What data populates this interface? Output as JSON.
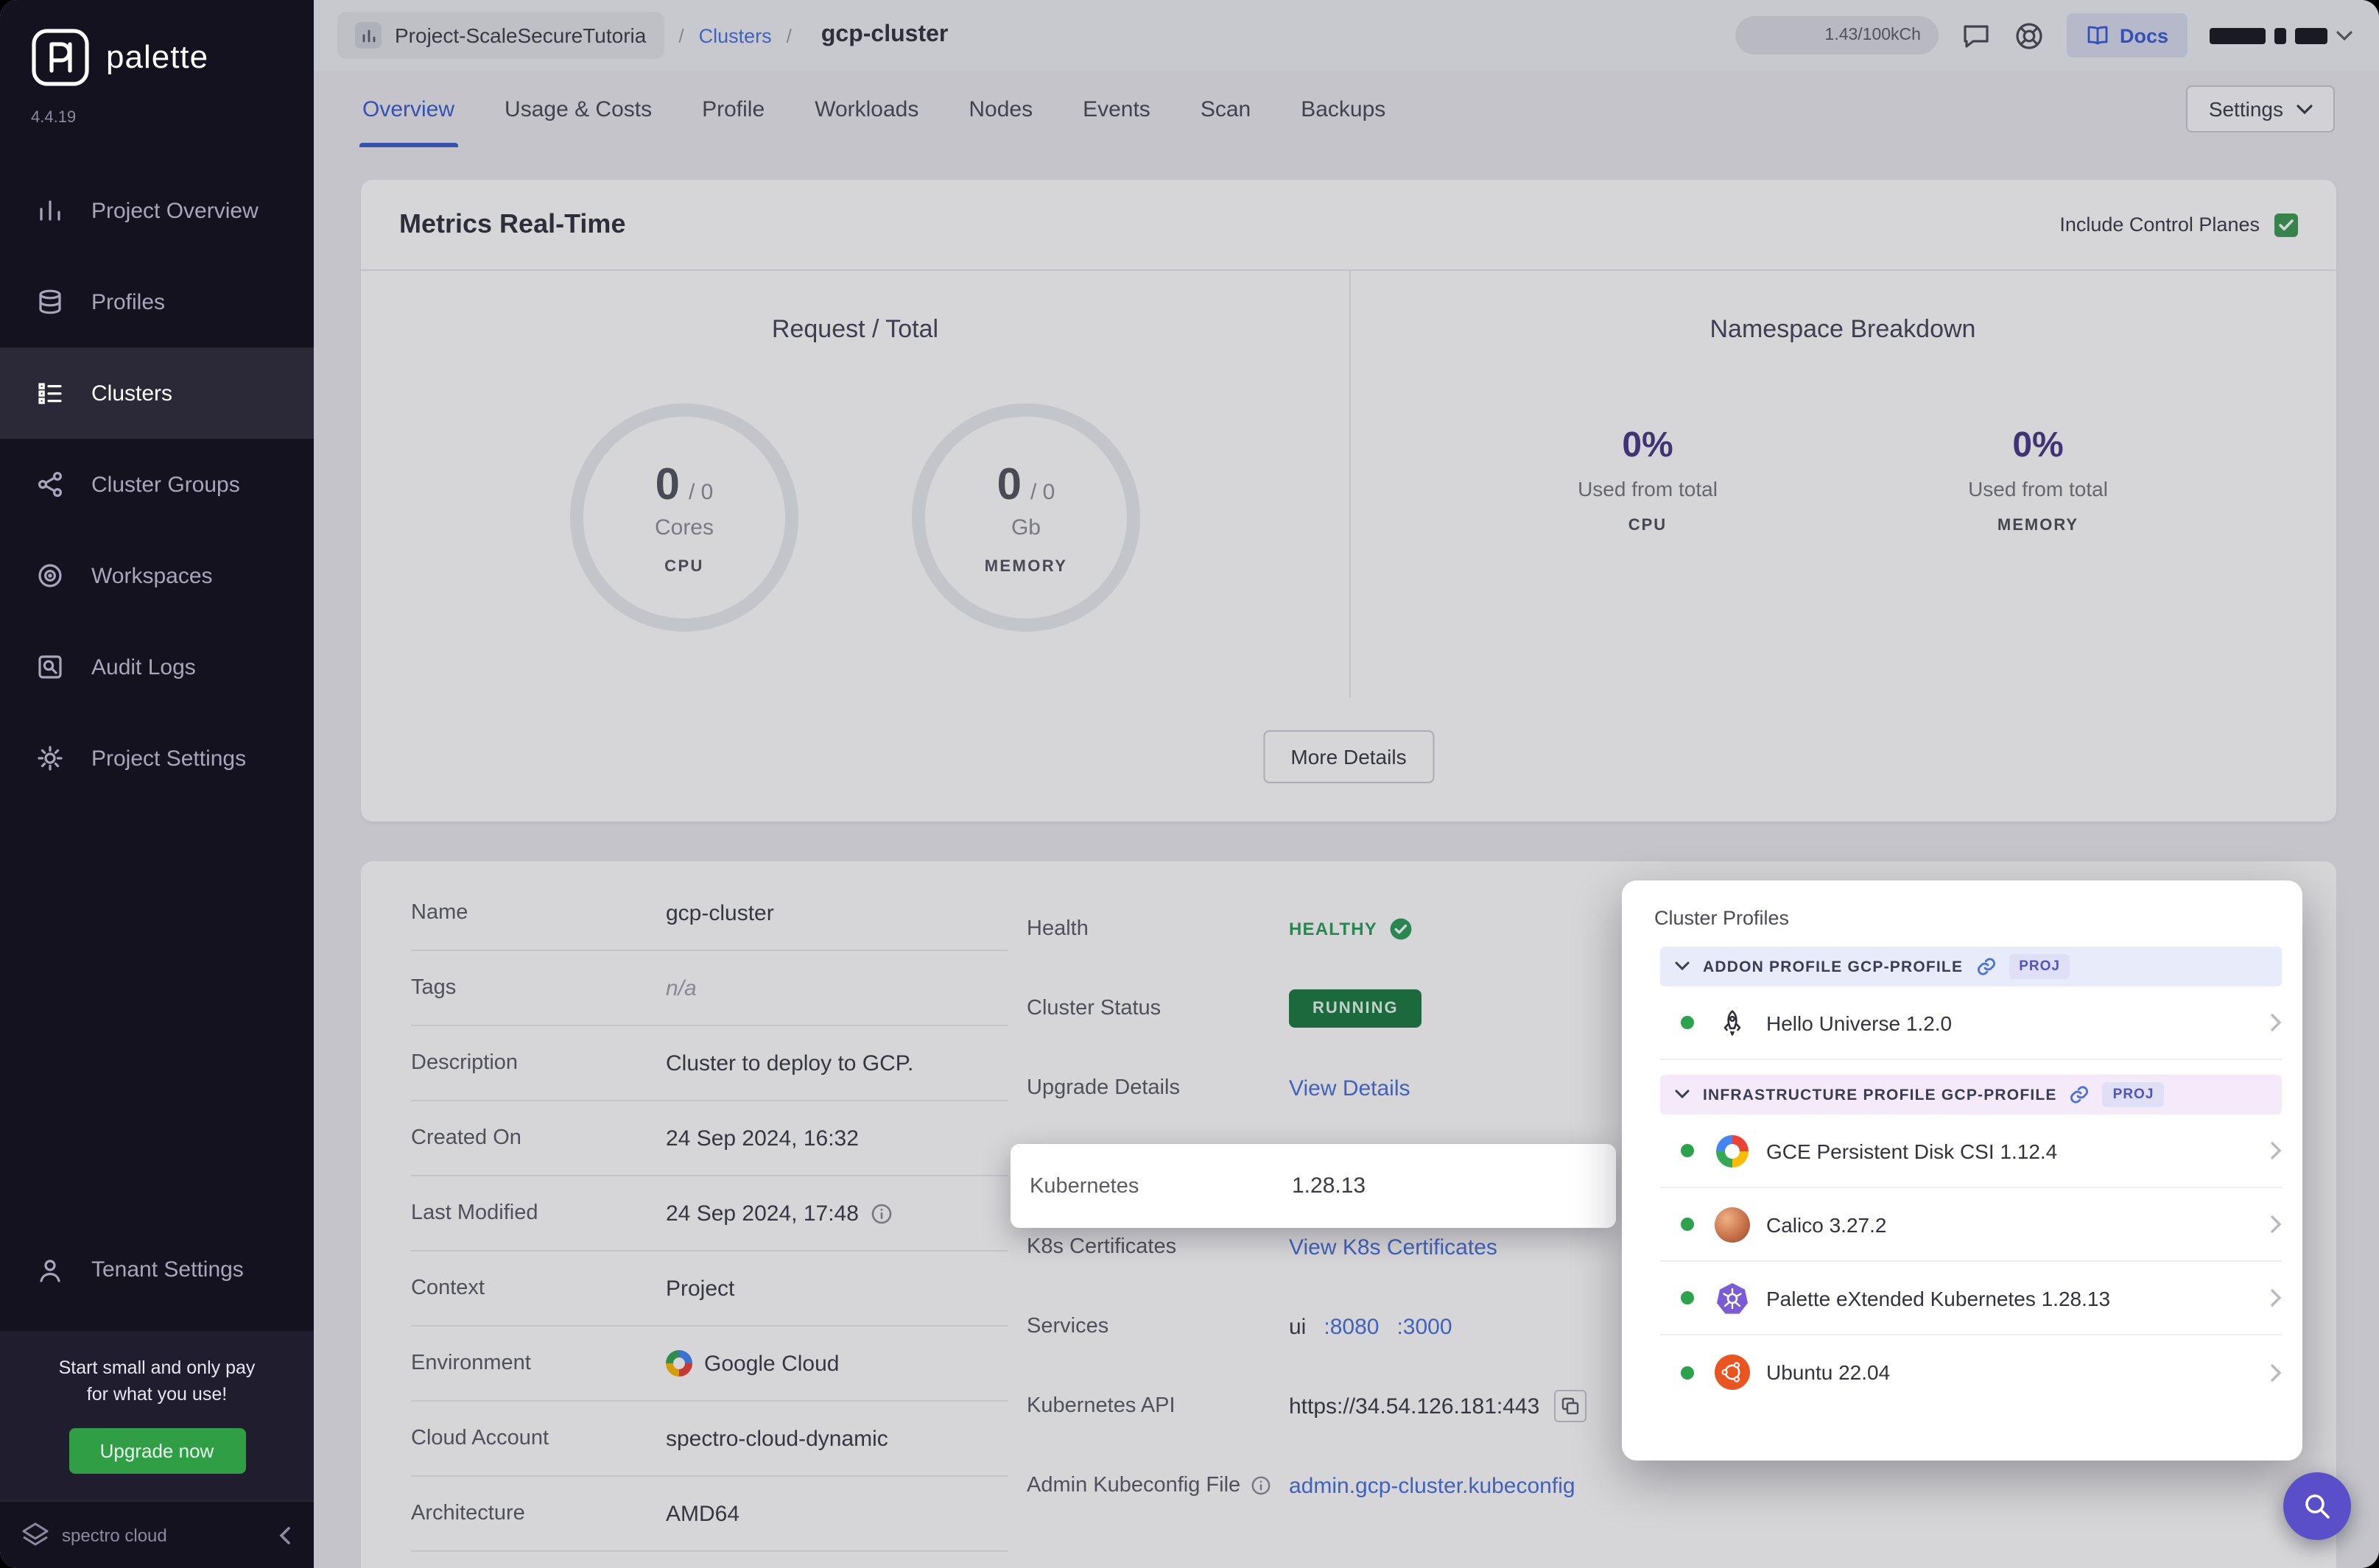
{
  "colors": {
    "accent_blue": "#3b5fd0",
    "link_blue": "#4a72dd",
    "healthy_green": "#2e9e5b",
    "running_green": "#1b7a41",
    "namespace_purple": "#4a3a85",
    "fab_purple": "#5a4fc9",
    "sidebar_bg": "#15121f"
  },
  "brand": {
    "name": "palette",
    "version": "4.4.19",
    "footer_logo": "spectro cloud"
  },
  "sidebar": {
    "items": [
      {
        "label": "Project Overview",
        "icon": "project-overview-icon"
      },
      {
        "label": "Profiles",
        "icon": "profiles-icon"
      },
      {
        "label": "Clusters",
        "icon": "clusters-icon",
        "active": true
      },
      {
        "label": "Cluster Groups",
        "icon": "cluster-groups-icon"
      },
      {
        "label": "Workspaces",
        "icon": "workspaces-icon"
      },
      {
        "label": "Audit Logs",
        "icon": "audit-logs-icon"
      },
      {
        "label": "Project Settings",
        "icon": "gear-icon"
      }
    ],
    "tenant_settings": "Tenant Settings",
    "promo_line1": "Start small and only pay",
    "promo_line2": "for what you use!",
    "upgrade_button": "Upgrade now"
  },
  "header": {
    "project": "Project-ScaleSecureTutoria",
    "separator": "/",
    "clusters_link": "Clusters",
    "cluster_name": "gcp-cluster",
    "usage": "1.43/100kCh",
    "docs_label": "Docs"
  },
  "tabs": {
    "items": [
      "Overview",
      "Usage & Costs",
      "Profile",
      "Workloads",
      "Nodes",
      "Events",
      "Scan",
      "Backups"
    ],
    "active": "Overview",
    "settings_label": "Settings"
  },
  "metrics": {
    "title": "Metrics Real-Time",
    "include_control_planes": "Include Control Planes",
    "request_total_title": "Request / Total",
    "cpu_gauge": {
      "value": "0",
      "total": "/ 0",
      "unit": "Cores",
      "metric": "CPU"
    },
    "memory_gauge": {
      "value": "0",
      "total": "/ 0",
      "unit": "Gb",
      "metric": "MEMORY"
    },
    "namespace_title": "Namespace Breakdown",
    "ns_cpu": {
      "pct": "0%",
      "caption": "Used from total",
      "metric": "CPU"
    },
    "ns_memory": {
      "pct": "0%",
      "caption": "Used from total",
      "metric": "MEMORY"
    },
    "more_details": "More Details"
  },
  "details": {
    "left": [
      {
        "label": "Name",
        "value": "gcp-cluster"
      },
      {
        "label": "Tags",
        "value": "n/a"
      },
      {
        "label": "Description",
        "value": "Cluster to deploy to GCP."
      },
      {
        "label": "Created On",
        "value": "24 Sep 2024, 16:32"
      },
      {
        "label": "Last Modified",
        "value": "24 Sep 2024, 17:48"
      },
      {
        "label": "Context",
        "value": "Project"
      },
      {
        "label": "Environment",
        "value": "Google Cloud"
      },
      {
        "label": "Cloud Account",
        "value": "spectro-cloud-dynamic"
      },
      {
        "label": "Architecture",
        "value": "AMD64"
      }
    ],
    "right": {
      "health_label": "Health",
      "health_value": "HEALTHY",
      "status_label": "Cluster Status",
      "status_value": "RUNNING",
      "upgrade_label": "Upgrade Details",
      "upgrade_link": "View Details",
      "kubernetes_label": "Kubernetes",
      "kubernetes_value": "1.28.13",
      "certs_label": "K8s Certificates",
      "certs_link": "View K8s Certificates",
      "services_label": "Services",
      "services_prefix": "ui",
      "services_link1": ":8080",
      "services_link2": ":3000",
      "api_label": "Kubernetes API",
      "api_value": "https://34.54.126.181:443",
      "kubeconfig_label": "Admin Kubeconfig File",
      "kubeconfig_link": "admin.gcp-cluster.kubeconfig"
    }
  },
  "profiles_panel": {
    "title": "Cluster Profiles",
    "groups": [
      {
        "label": "ADDON PROFILE GCP-PROFILE",
        "badge": "PROJ",
        "items": [
          {
            "name": "Hello Universe 1.2.0",
            "icon": "rocket-icon",
            "status": "green"
          }
        ]
      },
      {
        "label": "INFRASTRUCTURE PROFILE GCP-PROFILE",
        "badge": "PROJ",
        "items": [
          {
            "name": "GCE Persistent Disk CSI 1.12.4",
            "icon": "gce-disk-icon",
            "status": "green"
          },
          {
            "name": "Calico 3.27.2",
            "icon": "calico-icon",
            "status": "green"
          },
          {
            "name": "Palette eXtended Kubernetes 1.28.13",
            "icon": "kubernetes-icon",
            "status": "green"
          },
          {
            "name": "Ubuntu 22.04",
            "icon": "ubuntu-icon",
            "status": "green"
          }
        ]
      }
    ]
  }
}
